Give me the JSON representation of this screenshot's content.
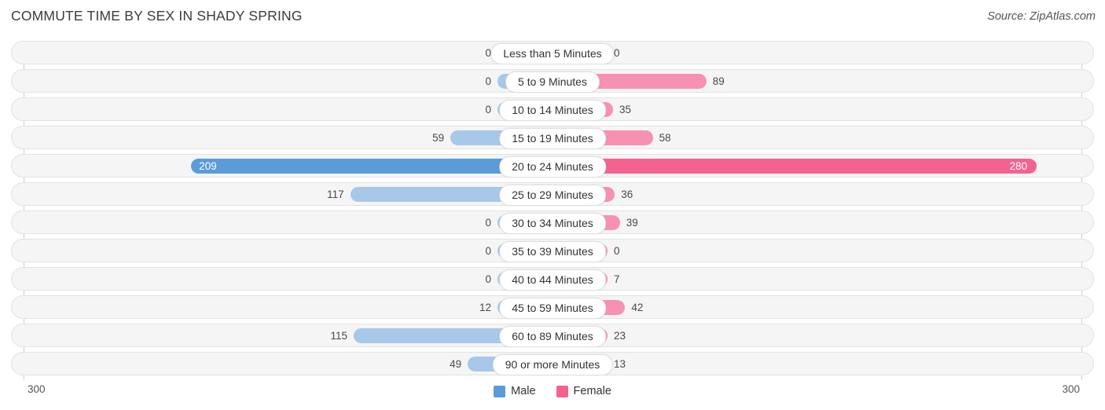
{
  "header": {
    "title": "COMMUTE TIME BY SEX IN SHADY SPRING",
    "source": "Source: ZipAtlas.com"
  },
  "legend": {
    "male_label": "Male",
    "female_label": "Female",
    "male_color": "#5b9bd8",
    "female_color": "#f4638f"
  },
  "axis": {
    "left_label": "300",
    "right_label": "300",
    "max": 300
  },
  "colors": {
    "male_light": "#a8c8ea",
    "male_max": "#5b9bd8",
    "female_light": "#f691b2",
    "female_max": "#f4638f",
    "track_fill": "#f5f5f5",
    "track_border": "#e3e3e3"
  },
  "chart_data": {
    "type": "bar",
    "title": "COMMUTE TIME BY SEX IN SHADY SPRING",
    "subtitle": "",
    "xlabel": "",
    "ylabel": "",
    "orientation": "horizontal-diverging",
    "axis_max": 300,
    "legend_position": "bottom-center",
    "grid": false,
    "categories": [
      "Less than 5 Minutes",
      "5 to 9 Minutes",
      "10 to 14 Minutes",
      "15 to 19 Minutes",
      "20 to 24 Minutes",
      "25 to 29 Minutes",
      "30 to 34 Minutes",
      "35 to 39 Minutes",
      "40 to 44 Minutes",
      "45 to 59 Minutes",
      "60 to 89 Minutes",
      "90 or more Minutes"
    ],
    "series": [
      {
        "name": "Male",
        "values": [
          0,
          0,
          0,
          59,
          209,
          117,
          0,
          0,
          0,
          12,
          115,
          49
        ]
      },
      {
        "name": "Female",
        "values": [
          0,
          89,
          35,
          58,
          280,
          36,
          39,
          0,
          7,
          42,
          23,
          13
        ]
      }
    ]
  },
  "rows": [
    {
      "category": "Less than 5 Minutes",
      "male": 0,
      "male_text": "0",
      "female": 0,
      "female_text": "0"
    },
    {
      "category": "5 to 9 Minutes",
      "male": 0,
      "male_text": "0",
      "female": 89,
      "female_text": "89"
    },
    {
      "category": "10 to 14 Minutes",
      "male": 0,
      "male_text": "0",
      "female": 35,
      "female_text": "35"
    },
    {
      "category": "15 to 19 Minutes",
      "male": 59,
      "male_text": "59",
      "female": 58,
      "female_text": "58"
    },
    {
      "category": "20 to 24 Minutes",
      "male": 209,
      "male_text": "209",
      "female": 280,
      "female_text": "280"
    },
    {
      "category": "25 to 29 Minutes",
      "male": 117,
      "male_text": "117",
      "female": 36,
      "female_text": "36"
    },
    {
      "category": "30 to 34 Minutes",
      "male": 0,
      "male_text": "0",
      "female": 39,
      "female_text": "39"
    },
    {
      "category": "35 to 39 Minutes",
      "male": 0,
      "male_text": "0",
      "female": 0,
      "female_text": "0"
    },
    {
      "category": "40 to 44 Minutes",
      "male": 0,
      "male_text": "0",
      "female": 7,
      "female_text": "7"
    },
    {
      "category": "45 to 59 Minutes",
      "male": 12,
      "male_text": "12",
      "female": 42,
      "female_text": "42"
    },
    {
      "category": "60 to 89 Minutes",
      "male": 115,
      "male_text": "115",
      "female": 23,
      "female_text": "23"
    },
    {
      "category": "90 or more Minutes",
      "male": 49,
      "male_text": "49",
      "female": 13,
      "female_text": "13"
    }
  ]
}
